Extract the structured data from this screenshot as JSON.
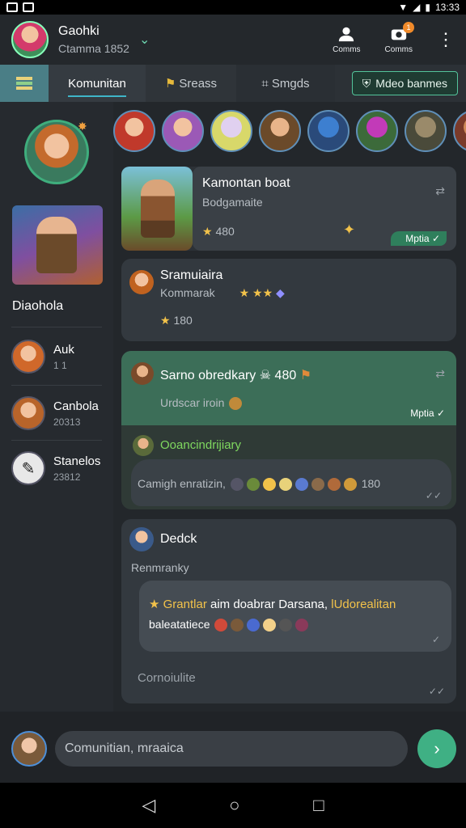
{
  "status": {
    "time": "13:33"
  },
  "header": {
    "title": "Gaohki",
    "subtitle": "Ctamma 1852",
    "actions": [
      {
        "label": "Comms",
        "icon": "person-icon"
      },
      {
        "label": "Comms",
        "icon": "camera-icon",
        "badge": "1"
      }
    ]
  },
  "tabs": {
    "active": "Komunitan",
    "tab2": "Sreass",
    "tab3": "Smgds",
    "pill": "Mdeo banmes"
  },
  "sidebar": {
    "profile_name": "Diaohola",
    "items": [
      {
        "name": "Auk",
        "count": "1     1"
      },
      {
        "name": "Canbola",
        "count": "20313"
      },
      {
        "name": "Stanelos",
        "count": "23812"
      }
    ]
  },
  "feed": {
    "card1": {
      "title": "Kamontan boat",
      "subtitle": "Bodgamaite",
      "score": "480",
      "verified": "Mptia"
    },
    "card2": {
      "title": "Sramuiaira",
      "subtitle": "Kommarak",
      "score": "180"
    },
    "card3": {
      "title": "Sarno obredkary",
      "score": "480",
      "subtitle": "Urdscar iroin",
      "verified": "Mptia",
      "reply_name": "Ooancindrijiary",
      "reply_text": "Camigh enratizin,",
      "reply_score": "180"
    },
    "card4": {
      "title": "Dedck",
      "subtitle": "Renmranky",
      "bubble_line1_a": "Grantlar",
      "bubble_line1_b": "aim doabrar Darsana,",
      "bubble_line1_c": "lUdorealitan",
      "bubble_line2": "baleatatiece",
      "footer": "Cornoiulite"
    }
  },
  "compose": {
    "placeholder": "Comunitian, mraaica"
  },
  "colors": {
    "accent": "#3fb084",
    "green_card": "#3c6e58",
    "bg": "#1f2226"
  }
}
